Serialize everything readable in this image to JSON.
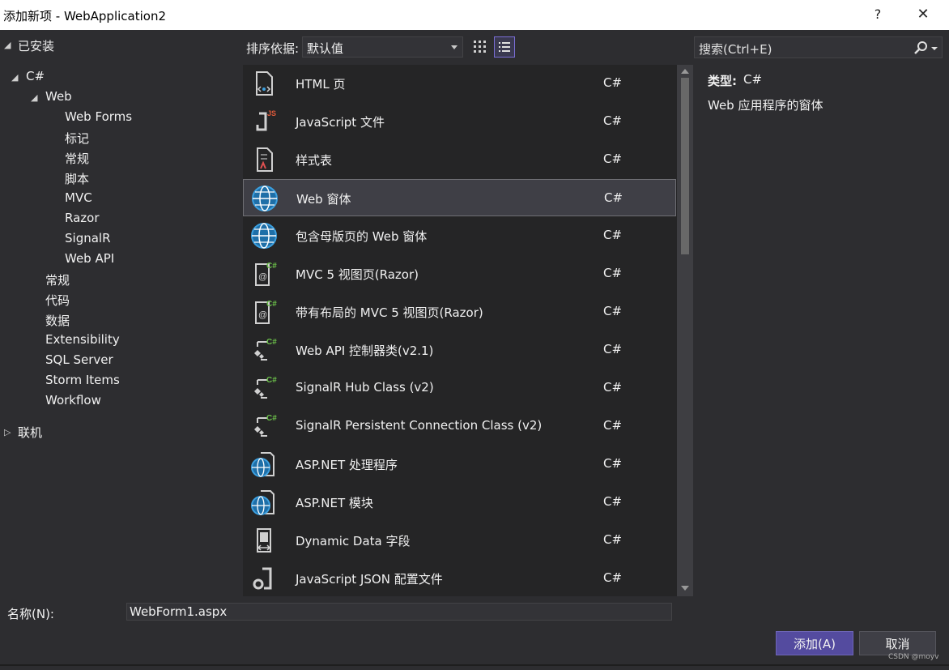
{
  "window": {
    "title": "添加新项 - WebApplication2",
    "help_glyph": "?",
    "close_glyph": "✕"
  },
  "tree": {
    "installed": "已安装",
    "csharp": "C#",
    "web": "Web",
    "web_children": [
      "Web Forms",
      "标记",
      "常规",
      "脚本",
      "MVC",
      "Razor",
      "SignalR",
      "Web API"
    ],
    "csharp_children": [
      "常规",
      "代码",
      "数据",
      "Extensibility",
      "SQL Server",
      "Storm Items",
      "Workflow"
    ],
    "online": "联机"
  },
  "toolbar": {
    "sort_label": "排序依据:",
    "sort_value": "默认值",
    "search_placeholder": "搜索(Ctrl+E)"
  },
  "templates": [
    {
      "name": "HTML 页",
      "lang": "C#",
      "icon": "html-page-icon"
    },
    {
      "name": "JavaScript 文件",
      "lang": "C#",
      "icon": "javascript-file-icon"
    },
    {
      "name": "样式表",
      "lang": "C#",
      "icon": "stylesheet-icon"
    },
    {
      "name": "Web 窗体",
      "lang": "C#",
      "icon": "web-form-globe-icon",
      "selected": true
    },
    {
      "name": "包含母版页的 Web 窗体",
      "lang": "C#",
      "icon": "web-form-globe-icon"
    },
    {
      "name": "MVC 5 视图页(Razor)",
      "lang": "C#",
      "icon": "razor-view-icon"
    },
    {
      "name": "带有布局的 MVC 5 视图页(Razor)",
      "lang": "C#",
      "icon": "razor-view-icon"
    },
    {
      "name": "Web API 控制器类(v2.1)",
      "lang": "C#",
      "icon": "csharp-class-icon"
    },
    {
      "name": "SignalR Hub Class (v2)",
      "lang": "C#",
      "icon": "csharp-class-icon"
    },
    {
      "name": "SignalR Persistent Connection Class (v2)",
      "lang": "C#",
      "icon": "csharp-class-icon"
    },
    {
      "name": "ASP.NET 处理程序",
      "lang": "C#",
      "icon": "handler-globe-icon"
    },
    {
      "name": "ASP.NET 模块",
      "lang": "C#",
      "icon": "handler-globe-icon"
    },
    {
      "name": "Dynamic Data 字段",
      "lang": "C#",
      "icon": "dynamic-data-icon"
    },
    {
      "name": "JavaScript JSON 配置文件",
      "lang": "C#",
      "icon": "json-config-icon"
    }
  ],
  "details": {
    "type_label": "类型:",
    "type_value": "C#",
    "description": "Web 应用程序的窗体"
  },
  "name_field": {
    "label": "名称(N):",
    "value": "WebForm1.aspx"
  },
  "buttons": {
    "add": "添加(A)",
    "cancel": "取消"
  },
  "watermark": "CSDN @moyv",
  "colors": {
    "accent": "#544b9f",
    "globe": "#3ca0e0",
    "background": "#2d2d30",
    "list_bg": "#252526"
  }
}
